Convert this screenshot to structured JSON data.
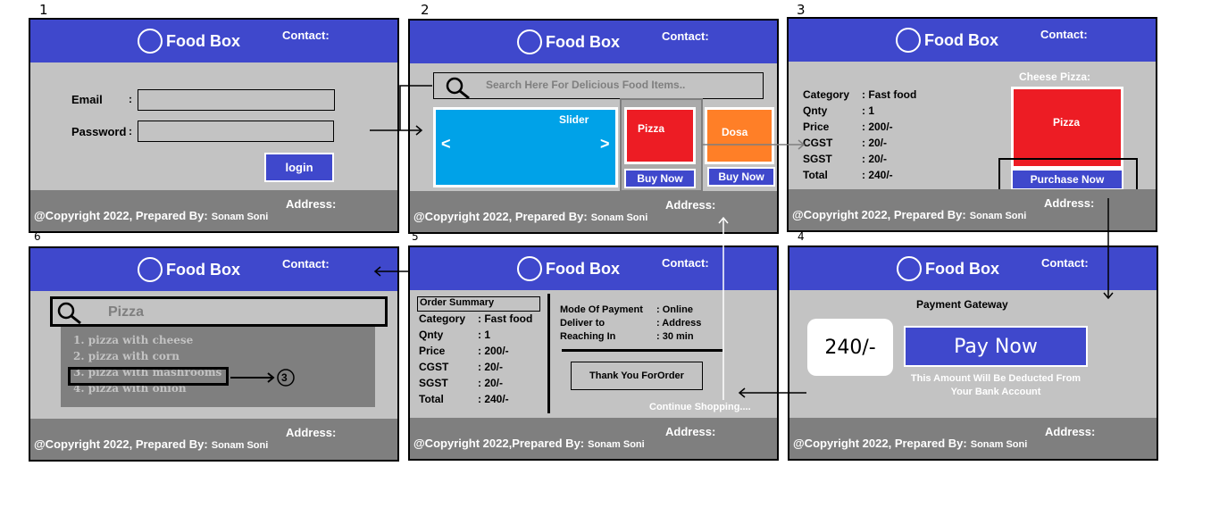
{
  "panel_numbers": [
    "1",
    "2",
    "3",
    "6",
    "5",
    "4"
  ],
  "common": {
    "brand": "Food Box",
    "contact": "Contact:",
    "address": "Address:",
    "copyright": "@Copyright 2022, Prepared By:",
    "copyright_alt": "@Copyright 2022,Prepared By:",
    "author": "Sonam Soni"
  },
  "login": {
    "email": "Email",
    "password": "Password",
    "colon": ":",
    "button": "login"
  },
  "home": {
    "search_placeholder": "Search Here For Delicious Food Items..",
    "slider": "Slider",
    "prev": "<",
    "next": ">",
    "items": [
      {
        "name": "Pizza",
        "color": "#ed1c24",
        "buy": "Buy Now"
      },
      {
        "name": "Dosa",
        "color": "#ff7f27",
        "buy": "Buy Now"
      }
    ]
  },
  "detail": {
    "title": "Cheese Pizza:",
    "image": "Pizza",
    "rows": [
      {
        "k": "Category",
        "v": ":  Fast food"
      },
      {
        "k": "Qnty",
        "v": ": 1"
      },
      {
        "k": "Price",
        "v": ": 200/-"
      },
      {
        "k": "CGST",
        "v": ": 20/-"
      },
      {
        "k": "SGST",
        "v": ": 20/-"
      },
      {
        "k": "Total",
        "v": ": 240/-"
      }
    ],
    "purchase": "Purchase Now"
  },
  "search": {
    "query": "Pizza",
    "results": [
      "1. pizza with cheese",
      "2. pizza with corn",
      "3. pizza with mashrooms",
      "4. pizza with onion"
    ],
    "annotation": "3"
  },
  "order": {
    "summary_title": "Order Summary",
    "rows": [
      {
        "k": "Category",
        "v": ":  Fast food"
      },
      {
        "k": "Qnty",
        "v": ": 1"
      },
      {
        "k": "Price",
        "v": ": 200/-"
      },
      {
        "k": "CGST",
        "v": ": 20/-"
      },
      {
        "k": "SGST",
        "v": ": 20/-"
      },
      {
        "k": "Total",
        "v": ": 240/-"
      }
    ],
    "info": [
      {
        "k": "Mode Of Payment",
        "v": ": Online"
      },
      {
        "k": "Deliver to",
        "v": ": Address"
      },
      {
        "k": "Reaching In",
        "v": ": 30 min"
      }
    ],
    "thanks": "Thank You ForOrder",
    "continue": "Continue Shopping...."
  },
  "payment": {
    "title": "Payment Gateway",
    "amount": "240/-",
    "pay": "Pay  Now",
    "note1": "This Amount Will Be Deducted From",
    "note2": "Your Bank Account"
  },
  "colors": {
    "header": "#3f48cc",
    "body": "#c3c3c3",
    "footer": "#7f7f7f",
    "slider": "#00a2e8"
  }
}
